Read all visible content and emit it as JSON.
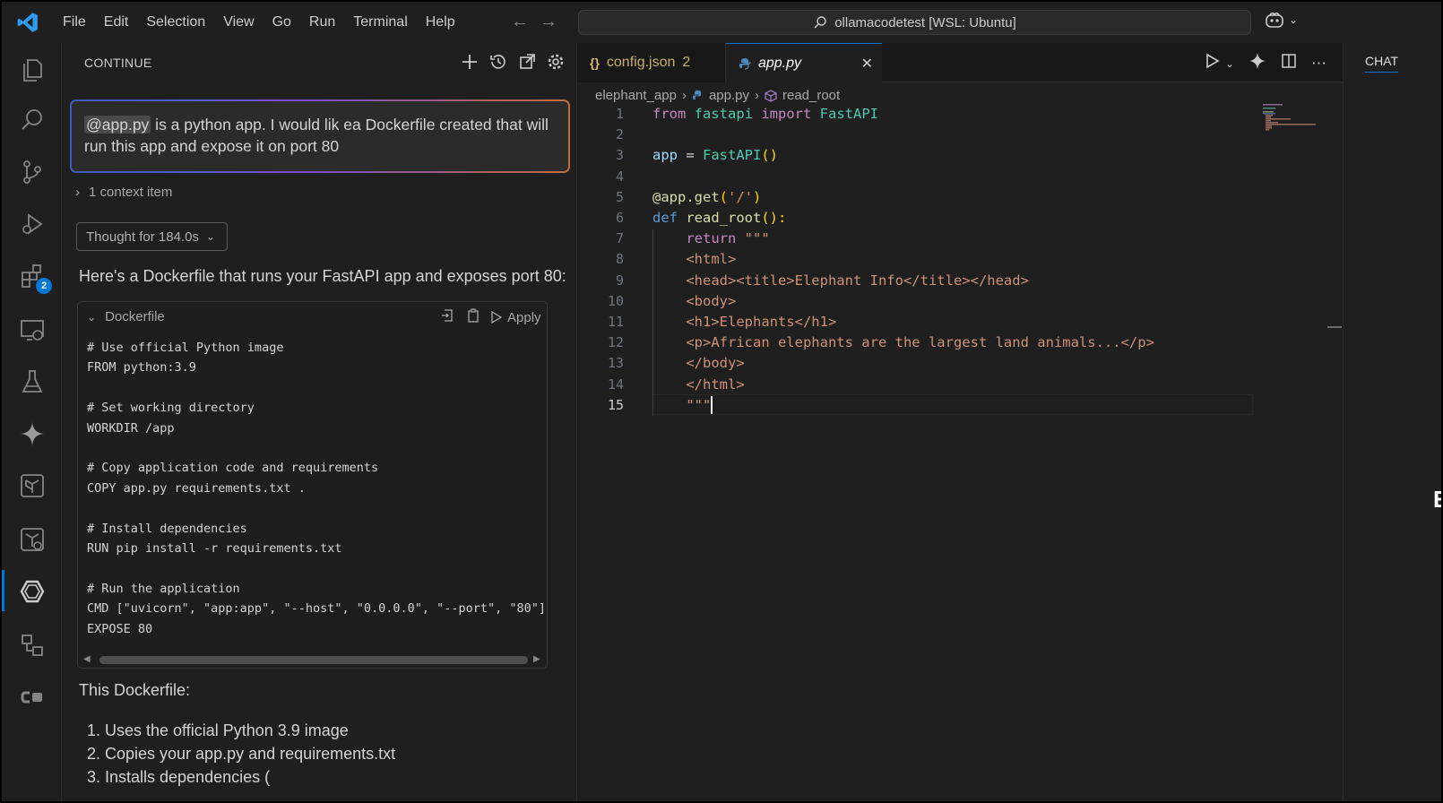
{
  "menu": [
    "File",
    "Edit",
    "Selection",
    "View",
    "Go",
    "Run",
    "Terminal",
    "Help"
  ],
  "command_center": "ollamacodetest [WSL: Ubuntu]",
  "activity_badge": "2",
  "continue_panel": {
    "title": "CONTINUE",
    "user_message": {
      "mention": "@app.py",
      "text": " is a python app. I would lik ea Dockerfile created that will run this app and expose it on port 80"
    },
    "context_items": "1 context item",
    "thought": "Thought for 184.0s",
    "reply_intro": "Here's a Dockerfile that runs your FastAPI app and exposes port 80:",
    "codeblock": {
      "filename": "Dockerfile",
      "apply_label": "Apply",
      "lines": [
        "# Use official Python image",
        "FROM python:3.9",
        "",
        "# Set working directory",
        "WORKDIR /app",
        "",
        "# Copy application code and requirements",
        "COPY app.py requirements.txt .",
        "",
        "# Install dependencies",
        "RUN pip install -r requirements.txt",
        "",
        "# Run the application",
        "CMD [\"uvicorn\", \"app:app\", \"--host\", \"0.0.0.0\", \"--port\", \"80\"]",
        "EXPOSE 80"
      ]
    },
    "after_text": "This Dockerfile:",
    "steps": [
      "Uses the official Python 3.9 image",
      "Copies your app.py and requirements.txt",
      "Installs dependencies ("
    ]
  },
  "editor": {
    "tabs": [
      {
        "label": "config.json",
        "badge": "2",
        "icon": "json-braces-icon"
      },
      {
        "label": "app.py",
        "icon": "python-icon"
      }
    ],
    "breadcrumb": [
      "elephant_app",
      "app.py",
      "read_root"
    ],
    "line_numbers": [
      "1",
      "2",
      "3",
      "4",
      "5",
      "6",
      "7",
      "8",
      "9",
      "10",
      "11",
      "12",
      "13",
      "14",
      "15"
    ],
    "code": {
      "l1": {
        "a": "from",
        "b": " fastapi ",
        "c": "import",
        "d": " FastAPI"
      },
      "l3": {
        "a": "app",
        "b": " = ",
        "c": "FastAPI",
        "d": "()"
      },
      "l5": {
        "a": "@app.get",
        "b": "(",
        "c": "'/'",
        "d": ")"
      },
      "l6": {
        "a": "def",
        "b": " ",
        "c": "read_root",
        "d": "():"
      },
      "l7": {
        "a": "    return",
        "b": " \"\"\""
      },
      "l8": "    <html>",
      "l9": "    <head><title>Elephant Info</title></head>",
      "l10": "    <body>",
      "l11": "    <h1>Elephants</h1>",
      "l12": "    <p>African elephants are the largest land animals...</p>",
      "l13": "    </body>",
      "l14": "    </html>",
      "l15": "    \"\"\""
    }
  },
  "chat_panel": {
    "tab": "CHAT"
  },
  "edge_glyph": "E"
}
